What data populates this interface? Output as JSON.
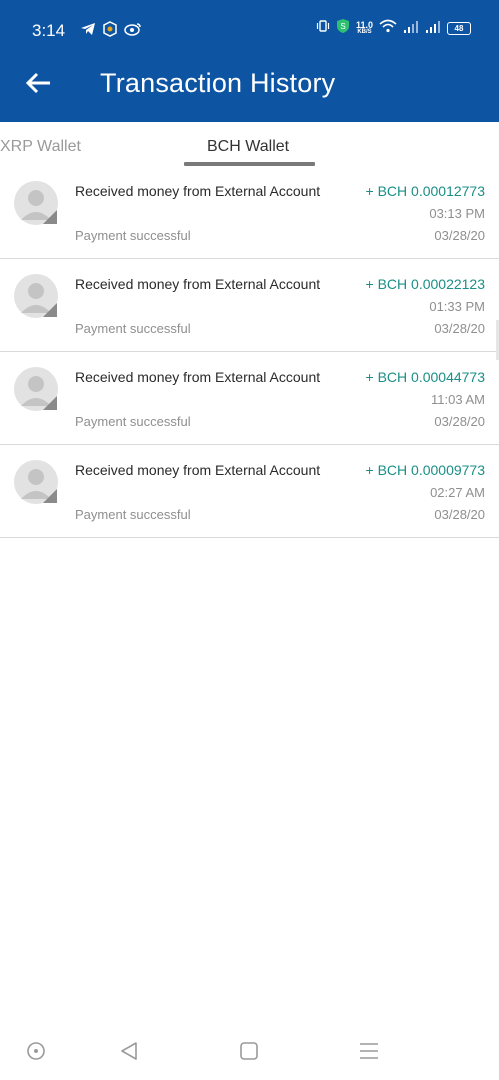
{
  "status_bar": {
    "time": "3:14",
    "speed_value": "11.0",
    "speed_unit": "KB/S",
    "battery": "48"
  },
  "header": {
    "title": "Transaction History",
    "color": "#0d55a3"
  },
  "tabs": [
    {
      "label": "XRP Wallet",
      "active": false
    },
    {
      "label": "BCH Wallet",
      "active": true
    }
  ],
  "transactions": [
    {
      "description": "Received money from External Account",
      "status": "Payment successful",
      "amount": "+ BCH 0.00012773",
      "time": "03:13 PM",
      "date": "03/28/20"
    },
    {
      "description": "Received money from External Account",
      "status": "Payment successful",
      "amount": "+ BCH 0.00022123",
      "time": "01:33 PM",
      "date": "03/28/20"
    },
    {
      "description": "Received money from External Account",
      "status": "Payment successful",
      "amount": "+ BCH 0.00044773",
      "time": "11:03 AM",
      "date": "03/28/20"
    },
    {
      "description": "Received money from External Account",
      "status": "Payment successful",
      "amount": "+ BCH 0.00009773",
      "time": "02:27 AM",
      "date": "03/28/20"
    }
  ],
  "colors": {
    "accent_amount": "#1a8f86",
    "muted_text": "#8f8f8f"
  },
  "icons": {
    "back": "arrow-left-icon",
    "avatar": "user-avatar-icon",
    "nav": [
      "circle-icon",
      "back-triangle-icon",
      "home-square-icon",
      "menu-lines-icon"
    ]
  }
}
